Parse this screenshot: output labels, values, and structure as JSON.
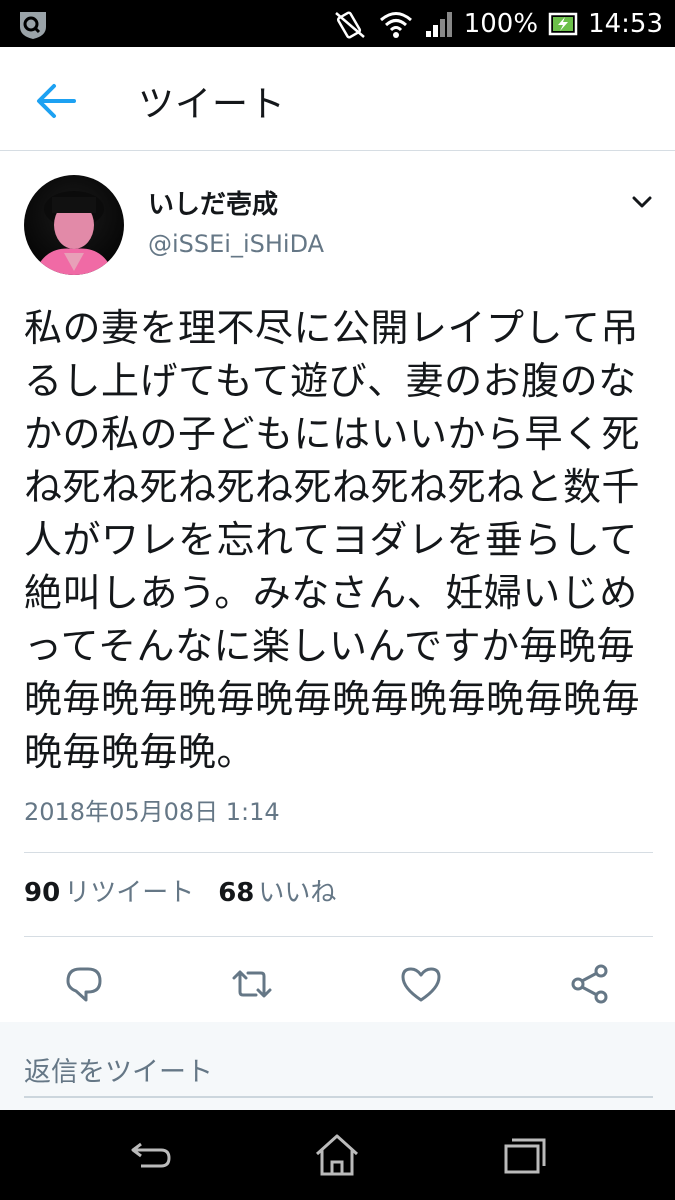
{
  "status_bar": {
    "battery": "100%",
    "time": "14:53"
  },
  "header": {
    "title": "ツイート"
  },
  "tweet": {
    "name": "いしだ壱成",
    "handle": "@iSSEi_iSHiDA",
    "text": "私の妻を理不尽に公開レイプして吊るし上げてもて遊び、妻のお腹のなかの私の子どもにはいいから早く死ね死ね死ね死ね死ね死ね死ねと数千人がワレを忘れてヨダレを垂らして絶叫しあう。みなさん、妊婦いじめってそんなに楽しいんですか毎晩毎晩毎晩毎晩毎晩毎晩毎晩毎晩毎晩毎晩毎晩毎晩。",
    "timestamp": "2018年05月08日 1:14",
    "retweets": "90",
    "retweets_label": "リツイート",
    "likes": "68",
    "likes_label": "いいね"
  },
  "reply": {
    "placeholder": "返信をツイート"
  },
  "icons": {
    "accent": "#1da1f2",
    "muted": "#657786"
  }
}
